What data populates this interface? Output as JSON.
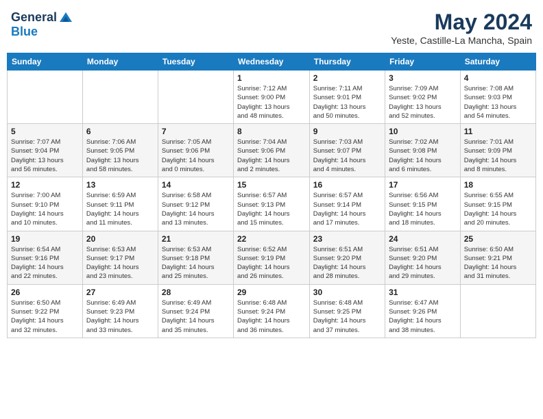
{
  "header": {
    "logo_general": "General",
    "logo_blue": "Blue",
    "month": "May 2024",
    "location": "Yeste, Castille-La Mancha, Spain"
  },
  "days_of_week": [
    "Sunday",
    "Monday",
    "Tuesday",
    "Wednesday",
    "Thursday",
    "Friday",
    "Saturday"
  ],
  "weeks": [
    [
      {
        "day": "",
        "info": ""
      },
      {
        "day": "",
        "info": ""
      },
      {
        "day": "",
        "info": ""
      },
      {
        "day": "1",
        "info": "Sunrise: 7:12 AM\nSunset: 9:00 PM\nDaylight: 13 hours\nand 48 minutes."
      },
      {
        "day": "2",
        "info": "Sunrise: 7:11 AM\nSunset: 9:01 PM\nDaylight: 13 hours\nand 50 minutes."
      },
      {
        "day": "3",
        "info": "Sunrise: 7:09 AM\nSunset: 9:02 PM\nDaylight: 13 hours\nand 52 minutes."
      },
      {
        "day": "4",
        "info": "Sunrise: 7:08 AM\nSunset: 9:03 PM\nDaylight: 13 hours\nand 54 minutes."
      }
    ],
    [
      {
        "day": "5",
        "info": "Sunrise: 7:07 AM\nSunset: 9:04 PM\nDaylight: 13 hours\nand 56 minutes."
      },
      {
        "day": "6",
        "info": "Sunrise: 7:06 AM\nSunset: 9:05 PM\nDaylight: 13 hours\nand 58 minutes."
      },
      {
        "day": "7",
        "info": "Sunrise: 7:05 AM\nSunset: 9:06 PM\nDaylight: 14 hours\nand 0 minutes."
      },
      {
        "day": "8",
        "info": "Sunrise: 7:04 AM\nSunset: 9:06 PM\nDaylight: 14 hours\nand 2 minutes."
      },
      {
        "day": "9",
        "info": "Sunrise: 7:03 AM\nSunset: 9:07 PM\nDaylight: 14 hours\nand 4 minutes."
      },
      {
        "day": "10",
        "info": "Sunrise: 7:02 AM\nSunset: 9:08 PM\nDaylight: 14 hours\nand 6 minutes."
      },
      {
        "day": "11",
        "info": "Sunrise: 7:01 AM\nSunset: 9:09 PM\nDaylight: 14 hours\nand 8 minutes."
      }
    ],
    [
      {
        "day": "12",
        "info": "Sunrise: 7:00 AM\nSunset: 9:10 PM\nDaylight: 14 hours\nand 10 minutes."
      },
      {
        "day": "13",
        "info": "Sunrise: 6:59 AM\nSunset: 9:11 PM\nDaylight: 14 hours\nand 11 minutes."
      },
      {
        "day": "14",
        "info": "Sunrise: 6:58 AM\nSunset: 9:12 PM\nDaylight: 14 hours\nand 13 minutes."
      },
      {
        "day": "15",
        "info": "Sunrise: 6:57 AM\nSunset: 9:13 PM\nDaylight: 14 hours\nand 15 minutes."
      },
      {
        "day": "16",
        "info": "Sunrise: 6:57 AM\nSunset: 9:14 PM\nDaylight: 14 hours\nand 17 minutes."
      },
      {
        "day": "17",
        "info": "Sunrise: 6:56 AM\nSunset: 9:15 PM\nDaylight: 14 hours\nand 18 minutes."
      },
      {
        "day": "18",
        "info": "Sunrise: 6:55 AM\nSunset: 9:15 PM\nDaylight: 14 hours\nand 20 minutes."
      }
    ],
    [
      {
        "day": "19",
        "info": "Sunrise: 6:54 AM\nSunset: 9:16 PM\nDaylight: 14 hours\nand 22 minutes."
      },
      {
        "day": "20",
        "info": "Sunrise: 6:53 AM\nSunset: 9:17 PM\nDaylight: 14 hours\nand 23 minutes."
      },
      {
        "day": "21",
        "info": "Sunrise: 6:53 AM\nSunset: 9:18 PM\nDaylight: 14 hours\nand 25 minutes."
      },
      {
        "day": "22",
        "info": "Sunrise: 6:52 AM\nSunset: 9:19 PM\nDaylight: 14 hours\nand 26 minutes."
      },
      {
        "day": "23",
        "info": "Sunrise: 6:51 AM\nSunset: 9:20 PM\nDaylight: 14 hours\nand 28 minutes."
      },
      {
        "day": "24",
        "info": "Sunrise: 6:51 AM\nSunset: 9:20 PM\nDaylight: 14 hours\nand 29 minutes."
      },
      {
        "day": "25",
        "info": "Sunrise: 6:50 AM\nSunset: 9:21 PM\nDaylight: 14 hours\nand 31 minutes."
      }
    ],
    [
      {
        "day": "26",
        "info": "Sunrise: 6:50 AM\nSunset: 9:22 PM\nDaylight: 14 hours\nand 32 minutes."
      },
      {
        "day": "27",
        "info": "Sunrise: 6:49 AM\nSunset: 9:23 PM\nDaylight: 14 hours\nand 33 minutes."
      },
      {
        "day": "28",
        "info": "Sunrise: 6:49 AM\nSunset: 9:24 PM\nDaylight: 14 hours\nand 35 minutes."
      },
      {
        "day": "29",
        "info": "Sunrise: 6:48 AM\nSunset: 9:24 PM\nDaylight: 14 hours\nand 36 minutes."
      },
      {
        "day": "30",
        "info": "Sunrise: 6:48 AM\nSunset: 9:25 PM\nDaylight: 14 hours\nand 37 minutes."
      },
      {
        "day": "31",
        "info": "Sunrise: 6:47 AM\nSunset: 9:26 PM\nDaylight: 14 hours\nand 38 minutes."
      },
      {
        "day": "",
        "info": ""
      }
    ]
  ]
}
